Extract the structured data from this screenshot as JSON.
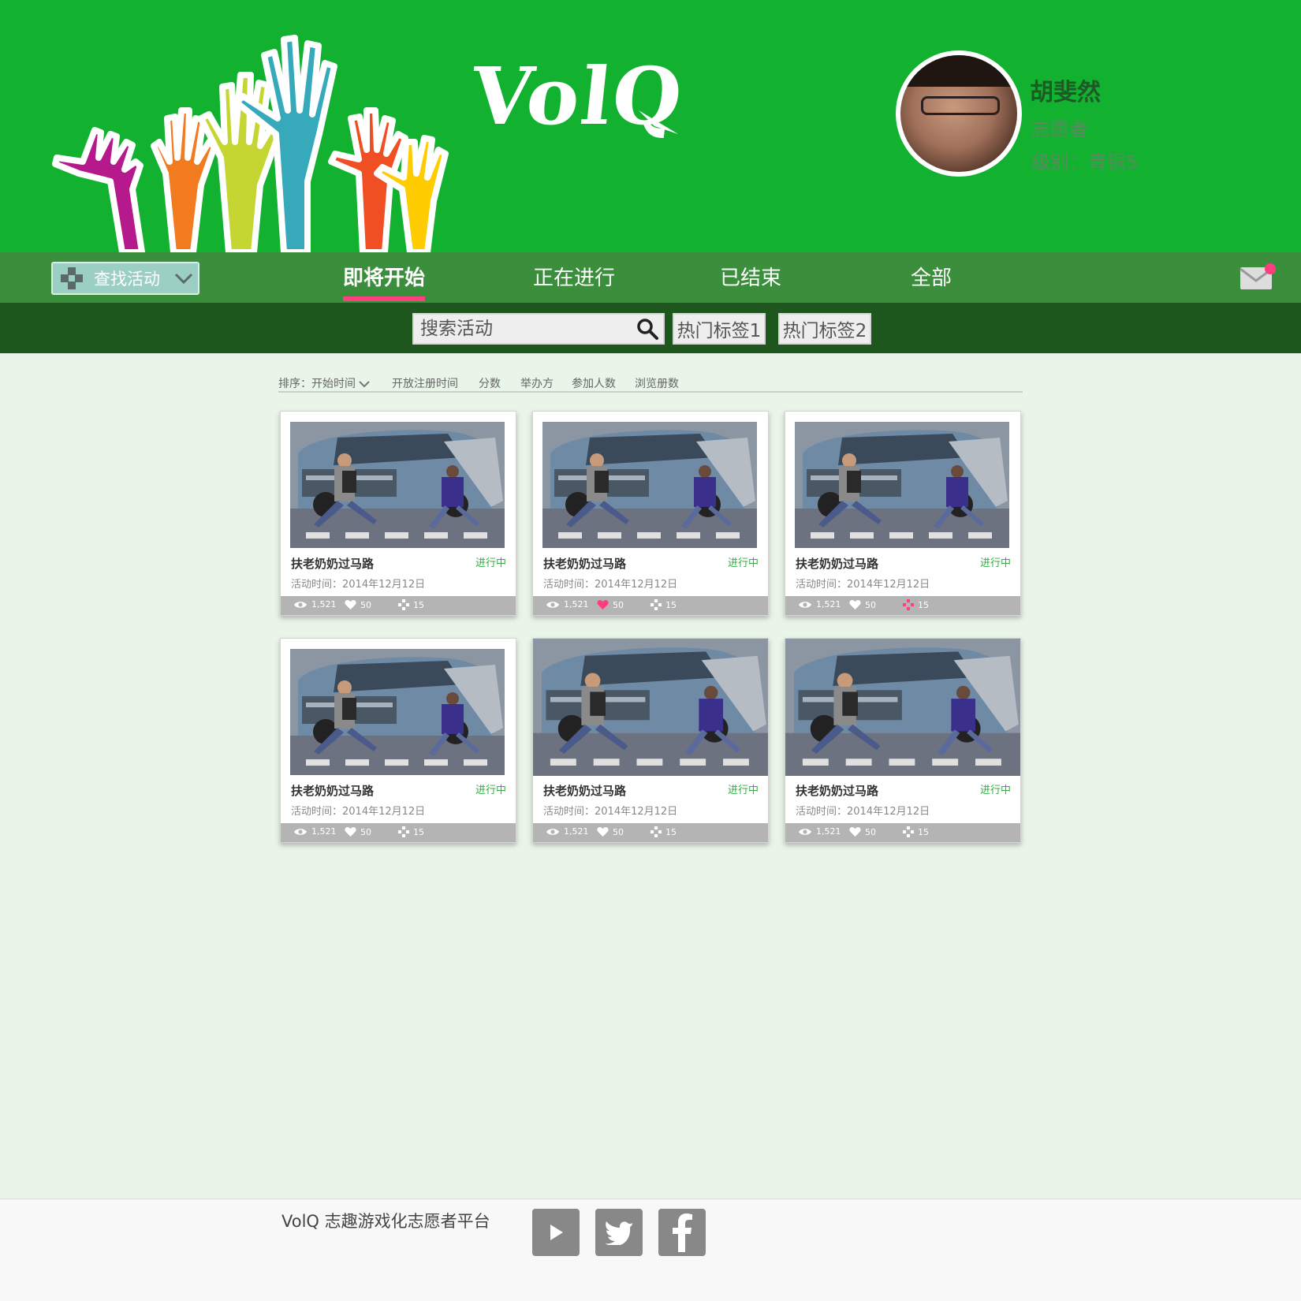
{
  "brand": {
    "logo_text": "VolQ"
  },
  "user": {
    "name": "胡斐然",
    "role": "志愿者",
    "level": "级别：青铜5"
  },
  "nav": {
    "find_label": "查找活动",
    "tabs": [
      {
        "label": "即将开始",
        "active": true
      },
      {
        "label": "正在进行",
        "active": false
      },
      {
        "label": "已结束",
        "active": false
      },
      {
        "label": "全部",
        "active": false
      }
    ]
  },
  "search": {
    "placeholder": "搜索活动",
    "tags": [
      "热门标签1",
      "热门标签2"
    ]
  },
  "sort": {
    "prefix": "排序：",
    "selected": "开始时间",
    "options": [
      "开放注册时间",
      "分数",
      "举办方",
      "参加人数",
      "浏览册数"
    ]
  },
  "cards": [
    {
      "title": "扶老奶奶过马路",
      "status": "进行中",
      "time": "活动时间：2014年12月12日",
      "views": "1,521",
      "likes": "50",
      "points": "15",
      "liked": false,
      "pointed": false
    },
    {
      "title": "扶老奶奶过马路",
      "status": "进行中",
      "time": "活动时间：2014年12月12日",
      "views": "1,521",
      "likes": "50",
      "points": "15",
      "liked": true,
      "pointed": false
    },
    {
      "title": "扶老奶奶过马路",
      "status": "进行中",
      "time": "活动时间：2014年12月12日",
      "views": "1,521",
      "likes": "50",
      "points": "15",
      "liked": false,
      "pointed": true
    },
    {
      "title": "扶老奶奶过马路",
      "status": "进行中",
      "time": "活动时间：2014年12月12日",
      "views": "1,521",
      "likes": "50",
      "points": "15",
      "liked": false,
      "pointed": false
    },
    {
      "title": "扶老奶奶过马路",
      "status": "进行中",
      "time": "活动时间：2014年12月12日",
      "views": "1,521",
      "likes": "50",
      "points": "15",
      "liked": false,
      "pointed": false
    },
    {
      "title": "扶老奶奶过马路",
      "status": "进行中",
      "time": "活动时间：2014年12月12日",
      "views": "1,521",
      "likes": "50",
      "points": "15",
      "liked": false,
      "pointed": false
    }
  ],
  "footer": {
    "text": "VolQ 志趣游戏化志愿者平台",
    "social_icons": [
      "youtube-icon",
      "twitter-icon",
      "facebook-icon"
    ]
  },
  "colors": {
    "header_green": "#12b230",
    "nav_green": "#3a8e3c",
    "search_green": "#1d571e",
    "accent_pink": "#ff3d7f",
    "status_green": "#2fae46"
  }
}
